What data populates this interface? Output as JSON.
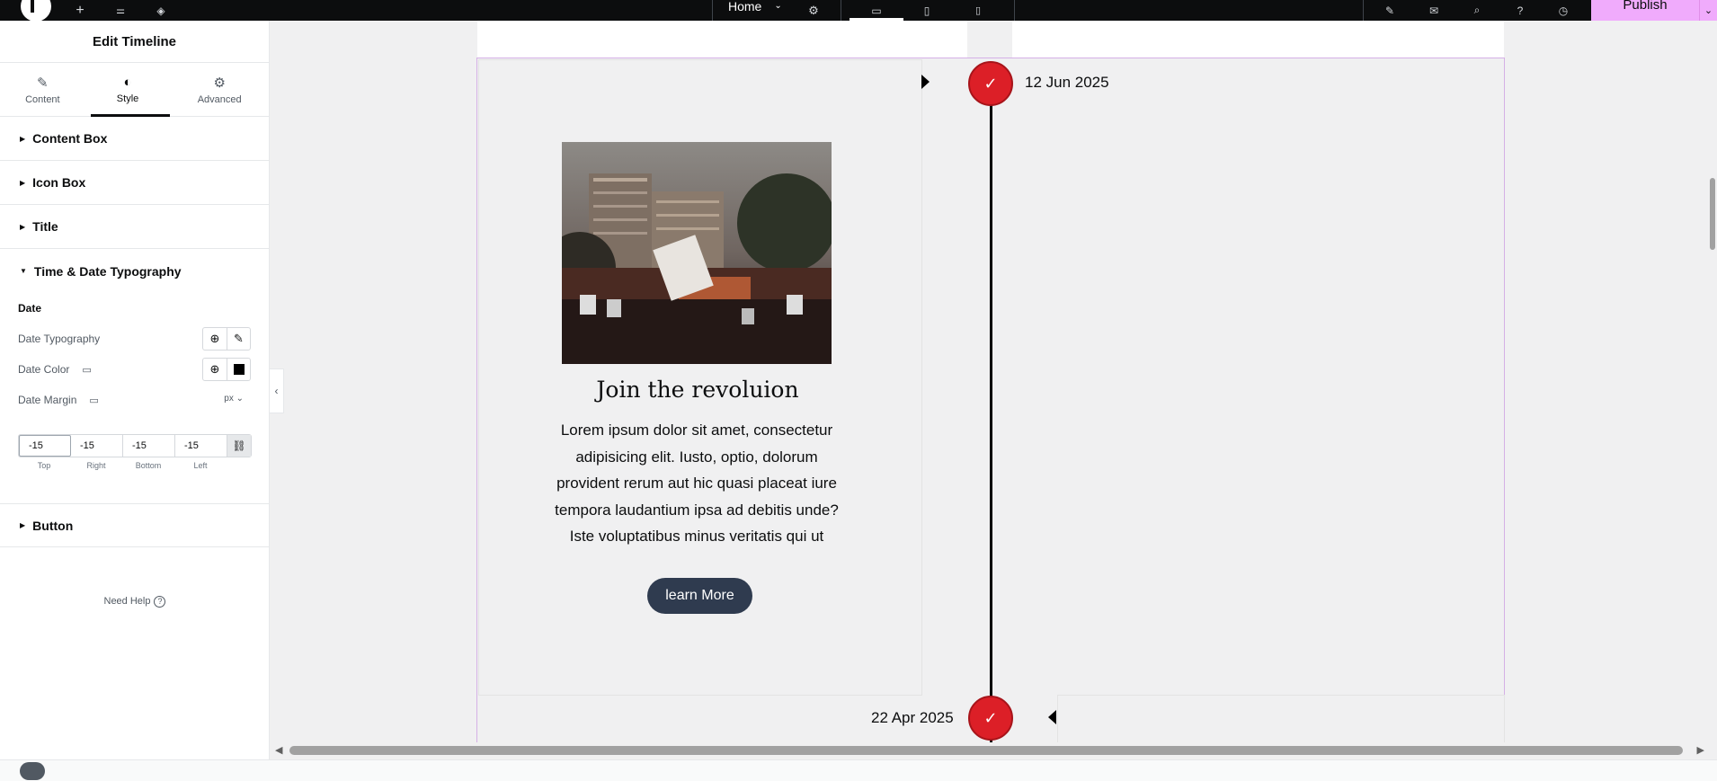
{
  "topbar": {
    "page_label": "Home",
    "publish_label": "Publish",
    "icons": [
      "elementor-logo-icon",
      "plus-icon",
      "sliders-icon",
      "layers-icon",
      "chevron-down-icon",
      "gear-icon",
      "desktop-icon",
      "tablet-icon",
      "mobile-icon",
      "brush-icon",
      "notes-icon",
      "search-icon",
      "help-icon",
      "circle-icon",
      "chevron-down-icon"
    ]
  },
  "panel": {
    "title": "Edit Timeline",
    "tabs": [
      {
        "label": "Content",
        "icon": "pencil-icon"
      },
      {
        "label": "Style",
        "icon": "contrast-icon",
        "active": true
      },
      {
        "label": "Advanced",
        "icon": "gear-icon"
      }
    ],
    "sections": {
      "content_box": "Content Box",
      "icon_box": "Icon Box",
      "title": "Title",
      "time_date": "Time & Date Typography",
      "button": "Button"
    },
    "date_heading": "Date",
    "date_typography_label": "Date Typography",
    "date_color_label": "Date Color",
    "date_color_value": "#000000",
    "date_margin_label": "Date Margin",
    "unit": "px",
    "margin": {
      "top": "-15",
      "right": "-15",
      "bottom": "-15",
      "left": "-15"
    },
    "margin_labels": {
      "top": "Top",
      "right": "Right",
      "bottom": "Bottom",
      "left": "Left"
    },
    "need_help": "Need Help"
  },
  "canvas": {
    "item1": {
      "date": "12 Jun 2025",
      "title": "Join the revoluion",
      "text": "Lorem ipsum dolor sit amet, consectetur adipisicing elit. Iusto, optio, dolorum provident rerum aut hic quasi placeat iure tempora laudantium ipsa ad debitis unde? Iste voluptatibus minus veritatis qui ut",
      "button": "learn More"
    },
    "item2": {
      "date": "22 Apr 2025"
    },
    "accent_color": "#dc1f27",
    "button_color": "#2f3b4f"
  }
}
